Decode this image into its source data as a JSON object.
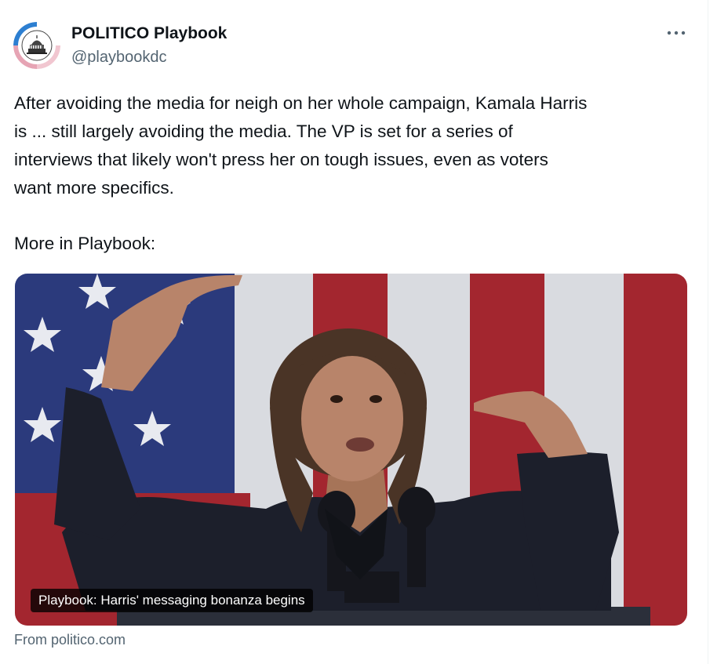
{
  "author": {
    "display_name": "POLITICO Playbook",
    "handle": "@playbookdc",
    "avatar_icon": "capitol-logo-icon"
  },
  "more_icon": "more-horizontal-icon",
  "tweet": {
    "lines": [
      "After avoiding the media for neigh on her whole campaign, Kamala Harris",
      "is ... still largely avoiding the media. The VP is set for a series of",
      "interviews that likely won't press her on tough issues, even as voters",
      "want more specifics."
    ],
    "more_line": "More in Playbook:"
  },
  "link_card": {
    "caption": "Playbook: Harris' messaging bonanza begins",
    "source": "From politico.com"
  },
  "colors": {
    "text": "#0f1419",
    "secondary_text": "#536471",
    "flag_red": "#a3262f",
    "flag_white": "#d9dbe0",
    "flag_blue": "#2b3a7c"
  }
}
